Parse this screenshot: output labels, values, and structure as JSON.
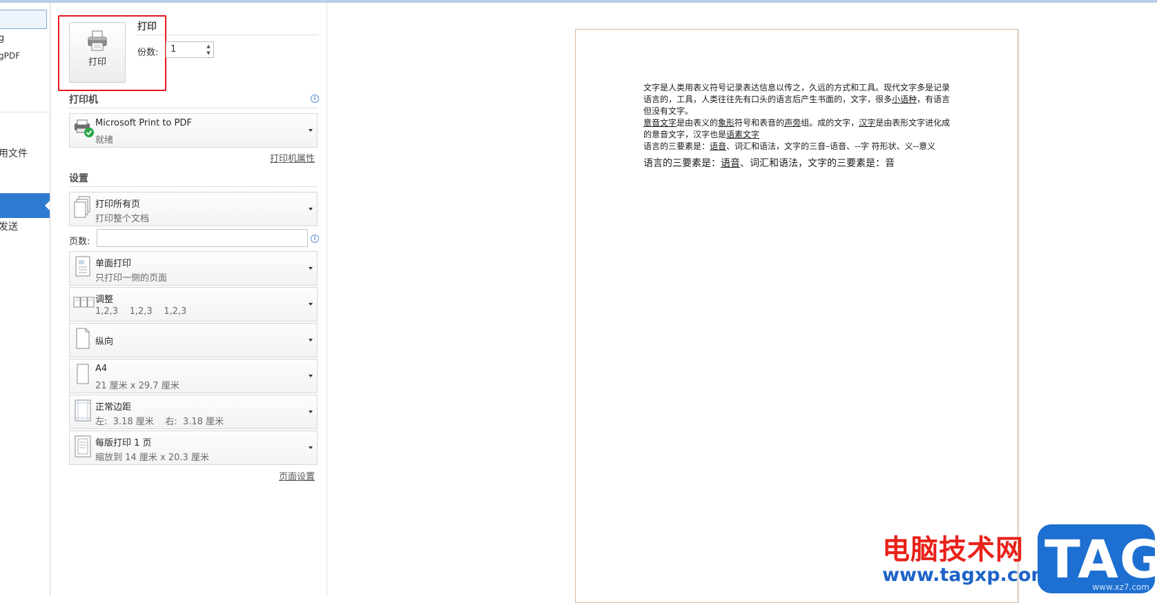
{
  "nav": {
    "item1": "g",
    "item2": "gPDF",
    "item3": "用文件",
    "item4": "发送"
  },
  "print": {
    "button_label": "打印",
    "heading": "打印",
    "copies_label": "份数:",
    "copies_value": "1"
  },
  "printer": {
    "section_title": "打印机",
    "name": "Microsoft Print to PDF",
    "status": "就绪",
    "properties_link": "打印机属性"
  },
  "settings": {
    "section_title": "设置",
    "pages_label": "页数:",
    "pages_value": "",
    "dropdowns": [
      {
        "title": "打印所有页",
        "subtitle": "打印整个文档",
        "icon": "pages-icon"
      },
      {
        "title": "单面打印",
        "subtitle": "只打印一侧的页面",
        "icon": "single-side-icon"
      },
      {
        "title": "调整",
        "subtitle": "1,2,3    1,2,3    1,2,3",
        "icon": "collate-icon"
      },
      {
        "title": "纵向",
        "subtitle": "",
        "icon": "portrait-icon"
      },
      {
        "title": "A4",
        "subtitle": "21 厘米 x 29.7 厘米",
        "icon": "paper-size-icon"
      },
      {
        "title": "正常边距",
        "subtitle": "左:  3.18 厘米    右:  3.18 厘米",
        "icon": "margins-icon"
      },
      {
        "title": "每版打印 1 页",
        "subtitle": "缩放到 14 厘米 x 20.3 厘米",
        "icon": "pages-per-sheet-icon"
      }
    ],
    "page_setup_link": "页面设置"
  },
  "preview": {
    "p1_a": "文字是人类用表义符号记录表达信息以传之，久远的方式和工具。现代文字多是记录语言的，工具，人类往往先有口头的语言后产生书面的，文字，很多",
    "p1_u": "小语种",
    "p1_b": "，有语言但没有文字。",
    "p2_u1": "意音文字",
    "p2_a": "是由表义的",
    "p2_u2": "象形",
    "p2_b": "符号和表音的",
    "p2_u3": "声旁",
    "p2_c": "组。成的文字，",
    "p2_u4": "汉字",
    "p2_d": "是由表形文字进化成的意音文字，汉字也是",
    "p2_u5": "语素文字",
    "p3_a": "语言的三要素是：",
    "p3_u": "语音",
    "p3_b": "、词汇和语法，文字的三音–语音、--字 符形状、义--意义",
    "p4_a": "语言的三要素是：",
    "p4_u": "语音",
    "p4_b": "、词汇和语法，文字的三要素是：音"
  },
  "watermark": {
    "site_name": "电脑技术网",
    "url": "www.tagxp.com",
    "tag": "TAG",
    "sub": "www.xz7.com"
  }
}
